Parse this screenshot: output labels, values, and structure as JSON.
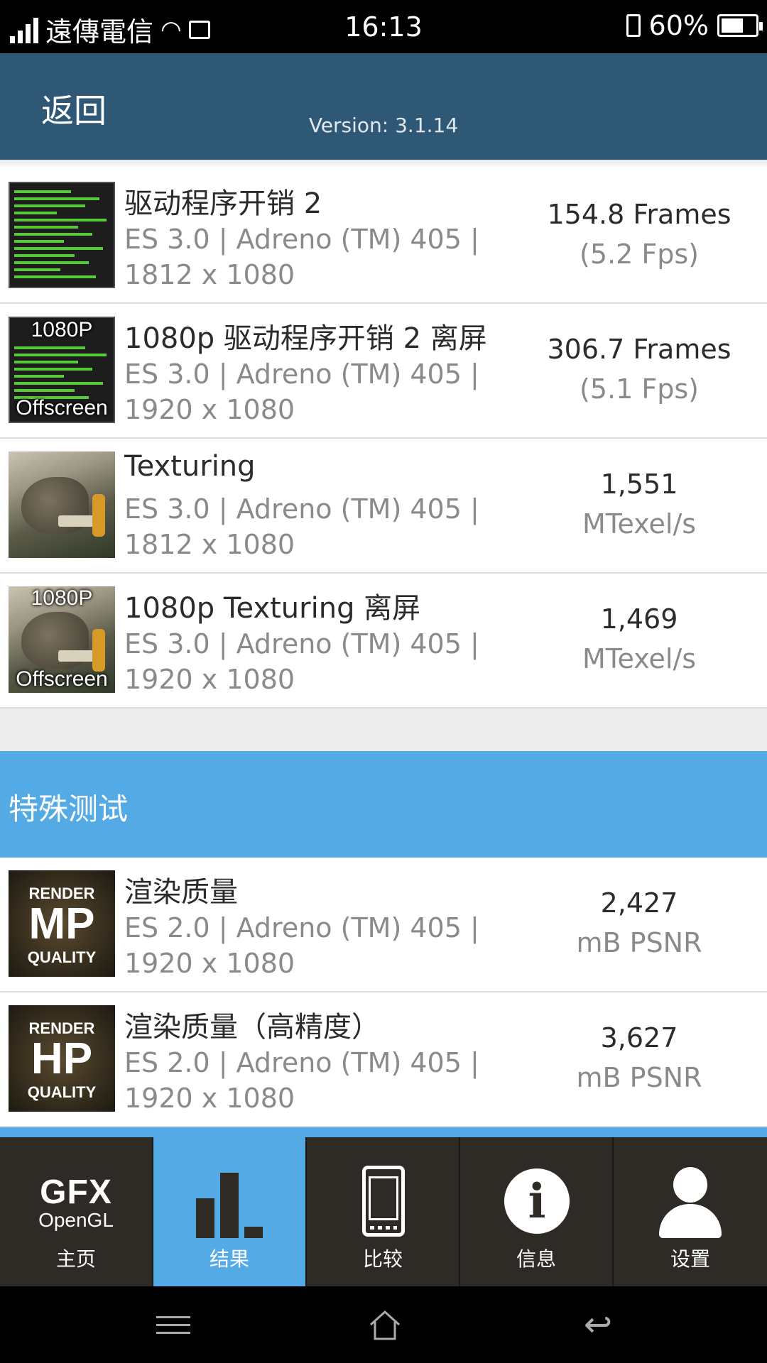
{
  "status_bar": {
    "carrier": "遠傳電信",
    "time": "16:13",
    "battery_percent": "60%",
    "battery_level": 0.6
  },
  "header": {
    "back_label": "返回",
    "version": "Version: 3.1.14"
  },
  "results": [
    {
      "title": "驱动程序开销 2",
      "sub1": "ES 3.0 | Adreno (TM) 405 |",
      "sub2": "1812 x 1080",
      "score": "154.8 Frames",
      "unit": "(5.2 Fps)",
      "thumb": "driver-overhead",
      "offscreen": false
    },
    {
      "title": "1080p 驱动程序开销 2 离屏",
      "sub1": "ES 3.0 | Adreno (TM) 405 |",
      "sub2": "1920 x 1080",
      "score": "306.7 Frames",
      "unit": "(5.1 Fps)",
      "thumb": "driver-overhead",
      "offscreen": true
    },
    {
      "title": "Texturing",
      "sub1": "ES 3.0 | Adreno (TM) 405 |",
      "sub2": "1812 x 1080",
      "score": "1,551",
      "unit": "MTexel/s",
      "thumb": "texturing",
      "offscreen": false
    },
    {
      "title": "1080p Texturing 离屏",
      "sub1": "ES 3.0 | Adreno (TM) 405 |",
      "sub2": "1920 x 1080",
      "score": "1,469",
      "unit": "MTexel/s",
      "thumb": "texturing",
      "offscreen": true
    }
  ],
  "thumb_labels": {
    "p1080": "1080P",
    "offscreen": "Offscreen"
  },
  "section": {
    "title": "特殊测试"
  },
  "special": [
    {
      "title": "渲染质量",
      "sub1": "ES 2.0 | Adreno (TM) 405 |",
      "sub2": "1920 x 1080",
      "score": "2,427",
      "unit": "mB PSNR",
      "badge_top": "RENDER",
      "badge_mid": "MP",
      "badge_bot": "QUALITY"
    },
    {
      "title": "渲染质量（高精度）",
      "sub1": "ES 2.0 | Adreno (TM) 405 |",
      "sub2": "1920 x 1080",
      "score": "3,627",
      "unit": "mB PSNR",
      "badge_top": "RENDER",
      "badge_mid": "HP",
      "badge_bot": "QUALITY"
    }
  ],
  "tabs": {
    "home": {
      "logo_top": "GFX",
      "logo_bottom": "OpenGL",
      "label": "主页"
    },
    "results": {
      "label": "结果"
    },
    "compare": {
      "label": "比较"
    },
    "info": {
      "label": "信息"
    },
    "settings": {
      "label": "设置"
    }
  },
  "colors": {
    "header": "#2e5875",
    "accent": "#53aae5",
    "tabbar": "#2e2a25"
  }
}
